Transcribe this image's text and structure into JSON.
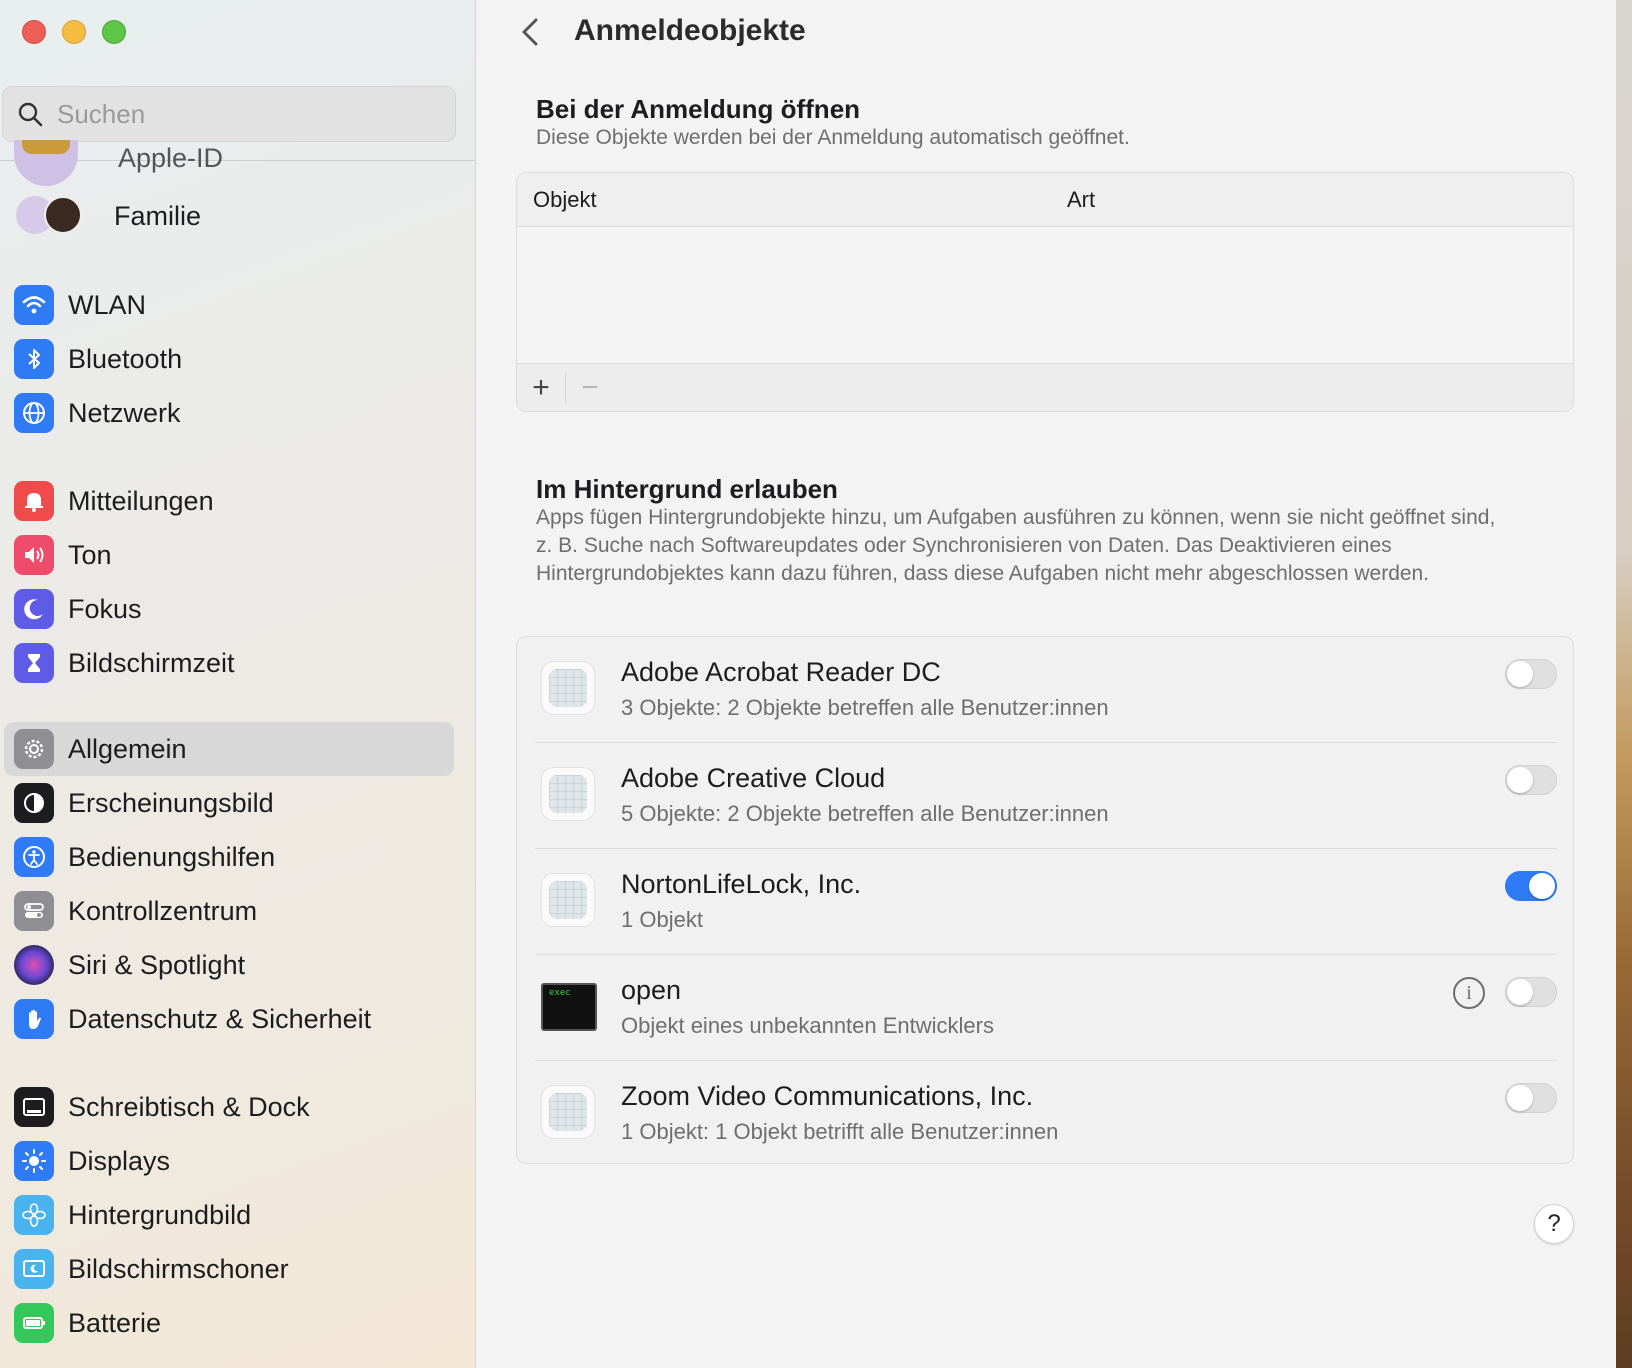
{
  "window": {
    "title": "Anmeldeobjekte"
  },
  "sidebar": {
    "search_placeholder": "Suchen",
    "account_items": [
      {
        "label": "Apple-ID"
      },
      {
        "label": "Familie"
      }
    ],
    "groups": [
      [
        {
          "label": "WLAN",
          "icon": "wifi-icon",
          "color": "#2f7bf6"
        },
        {
          "label": "Bluetooth",
          "icon": "bluetooth-icon",
          "color": "#2f7bf6"
        },
        {
          "label": "Netzwerk",
          "icon": "globe-icon",
          "color": "#2f7bf6"
        }
      ],
      [
        {
          "label": "Mitteilungen",
          "icon": "bell-icon",
          "color": "#ef4b4b"
        },
        {
          "label": "Ton",
          "icon": "speaker-icon",
          "color": "#ef4b6b"
        },
        {
          "label": "Fokus",
          "icon": "moon-icon",
          "color": "#5e5ce6"
        },
        {
          "label": "Bildschirmzeit",
          "icon": "hourglass-icon",
          "color": "#5e5ce6"
        }
      ],
      [
        {
          "label": "Allgemein",
          "icon": "gear-icon",
          "color": "#8e8e93",
          "selected": true
        },
        {
          "label": "Erscheinungsbild",
          "icon": "appearance-icon",
          "color": "#1d1d1f"
        },
        {
          "label": "Bedienungshilfen",
          "icon": "accessibility-icon",
          "color": "#2f7bf6"
        },
        {
          "label": "Kontrollzentrum",
          "icon": "switches-icon",
          "color": "#8e8e93"
        },
        {
          "label": "Siri & Spotlight",
          "icon": "siri-icon",
          "color": "#3a2d6d"
        },
        {
          "label": "Datenschutz & Sicherheit",
          "icon": "hand-icon",
          "color": "#2f7bf6"
        }
      ],
      [
        {
          "label": "Schreibtisch & Dock",
          "icon": "dock-icon",
          "color": "#1d1d1f"
        },
        {
          "label": "Displays",
          "icon": "sun-icon",
          "color": "#2f7bf6"
        },
        {
          "label": "Hintergrundbild",
          "icon": "flower-icon",
          "color": "#49b3f0"
        },
        {
          "label": "Bildschirmschoner",
          "icon": "screensaver-icon",
          "color": "#49b3f0"
        },
        {
          "label": "Batterie",
          "icon": "battery-icon",
          "color": "#34c759"
        }
      ]
    ]
  },
  "login_section": {
    "title": "Bei der Anmeldung öffnen",
    "subtitle": "Diese Objekte werden bei der Anmeldung automatisch geöffnet.",
    "columns": [
      "Objekt",
      "Art"
    ],
    "rows": [],
    "add_label": "+",
    "remove_label": "−"
  },
  "background_section": {
    "title": "Im Hintergrund erlauben",
    "description": "Apps fügen Hintergrundobjekte hinzu, um Aufgaben ausführen zu können, wenn sie nicht geöffnet sind, z. B. Suche nach Softwareupdates oder Synchronisieren von Daten. Das Deaktivieren eines Hintergrundobjektes kann dazu führen, dass diese Aufgaben nicht mehr abgeschlossen werden.",
    "items": [
      {
        "name": "Adobe Acrobat Reader DC",
        "detail": "3 Objekte: 2 Objekte betreffen alle Benutzer:innen",
        "enabled": false,
        "icon": "app-placeholder-icon"
      },
      {
        "name": "Adobe Creative Cloud",
        "detail": "5 Objekte: 2 Objekte betreffen alle Benutzer:innen",
        "enabled": false,
        "icon": "app-placeholder-icon"
      },
      {
        "name": "NortonLifeLock, Inc.",
        "detail": "1 Objekt",
        "enabled": true,
        "icon": "app-placeholder-icon"
      },
      {
        "name": "open",
        "detail": "Objekt eines unbekannten Entwicklers",
        "enabled": false,
        "icon": "terminal-exec-icon",
        "exec_label": "exec",
        "has_info": true
      },
      {
        "name": "Zoom Video Communications, Inc.",
        "detail": "1 Objekt: 1 Objekt betrifft alle Benutzer:innen",
        "enabled": false,
        "icon": "app-placeholder-icon"
      }
    ]
  },
  "help_label": "?",
  "colors": {
    "accent": "#2f7bf6",
    "selected_row": "#d8d8d8"
  }
}
